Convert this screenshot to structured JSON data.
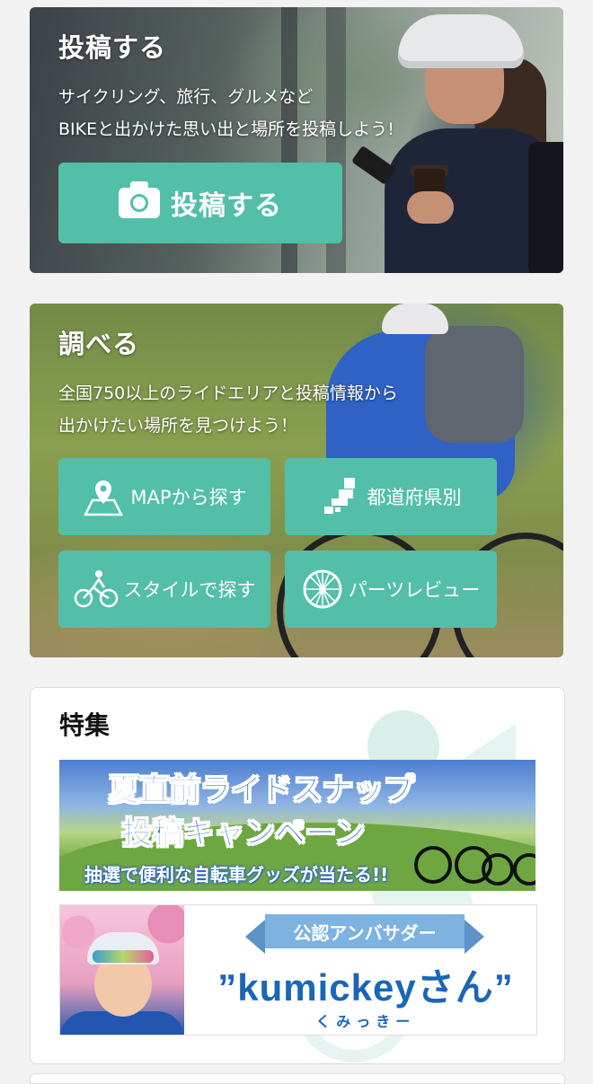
{
  "post": {
    "title": "投稿する",
    "text_line1": "サイクリング、旅行、グルメなど",
    "text_line2": "BIKEと出かけた思い出と場所を投稿しよう!",
    "button_label": "投稿する",
    "button_icon": "camera-icon"
  },
  "search": {
    "title": "調べる",
    "text_line1": "全国750以上のライドエリアと投稿情報から",
    "text_line2": "出かけたい場所を見つけよう！",
    "buttons": [
      {
        "label": "MAPから探す",
        "icon": "map-pin-icon"
      },
      {
        "label": "都道府県別",
        "icon": "japan-map-icon"
      },
      {
        "label": "スタイルで探す",
        "icon": "cyclist-icon"
      },
      {
        "label": "パーツレビュー",
        "icon": "wheel-icon"
      }
    ]
  },
  "features": {
    "title": "特集",
    "banner1": {
      "line1": "夏直前ライドスナップ",
      "line2": "投稿キャンペーン",
      "subtitle": "抽選で便利な自転車グッズが当たる!!"
    },
    "banner2": {
      "ribbon": "公認アンバサダー",
      "name": "”kumickeyさん”",
      "reading": "くみっきー"
    }
  },
  "colors": {
    "accent": "#53bfa8",
    "banner_blue": "#1e5fc6"
  }
}
